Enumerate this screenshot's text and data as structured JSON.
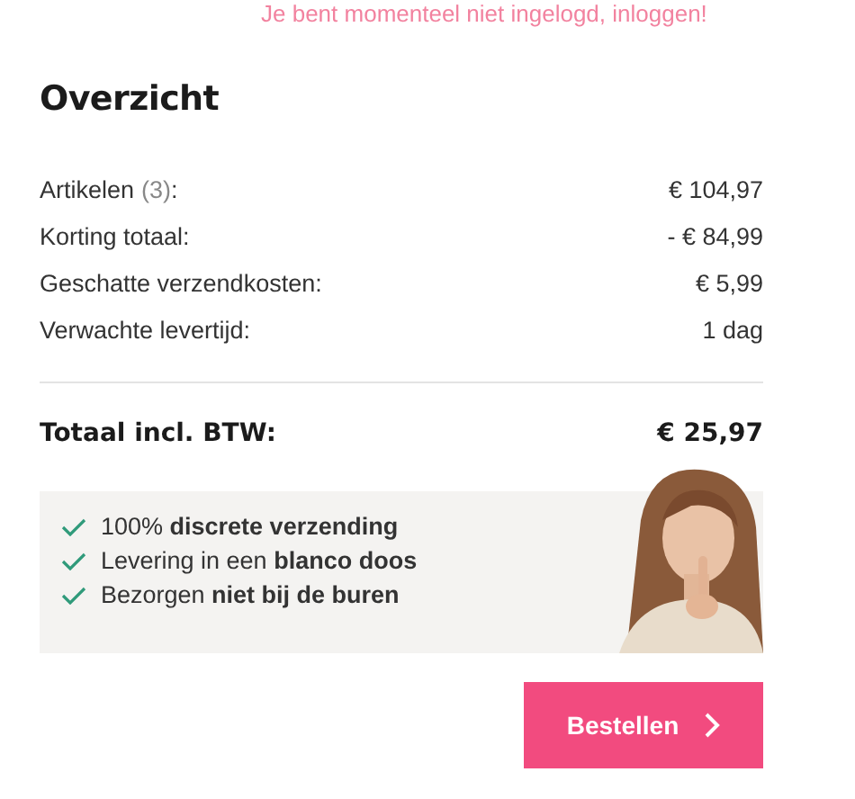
{
  "login_notice": {
    "text": "Je bent momenteel niet ingelogd, ",
    "link": "inloggen!"
  },
  "title": "Overzicht",
  "rows": [
    {
      "label": "Artikelen",
      "count": "(3)",
      "suffix": ":",
      "value": "€ 104,97"
    },
    {
      "label": "Korting totaal:",
      "value": "- € 84,99"
    },
    {
      "label": "Geschatte verzendkosten:",
      "value": "€ 5,99"
    },
    {
      "label": "Verwachte levertijd:",
      "value": "1 dag"
    }
  ],
  "total": {
    "label": "Totaal incl. BTW:",
    "value": "€ 25,97"
  },
  "benefits": [
    "100% **discrete verzending**",
    "Levering in een **blanco doos**",
    " Bezorgen **niet bij de buren**"
  ],
  "banner_image": {
    "kind": "picture"
  },
  "order_button": "Bestellen"
}
